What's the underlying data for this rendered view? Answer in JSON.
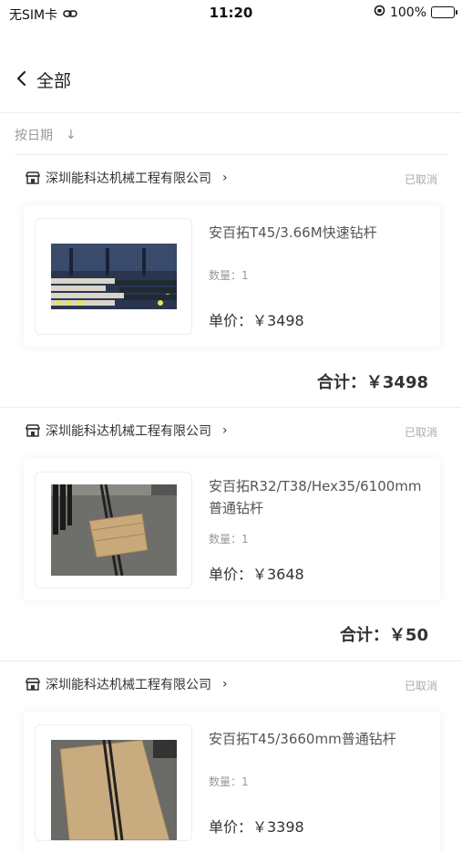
{
  "status_bar": {
    "carrier": "无SIM卡",
    "time": "11:20",
    "battery": "100%"
  },
  "nav": {
    "title": "全部"
  },
  "sort": {
    "label": "按日期",
    "arrow": "↓"
  },
  "orders": [
    {
      "shop": "深圳能科达机械工程有限公司",
      "status": "已取消",
      "product_line1": "安百拓T45/3.66M快速钻杆",
      "product_line2": "",
      "qty_label": "数量：1",
      "unit_price": "单价：￥3498",
      "total": "合计：￥3498"
    },
    {
      "shop": "深圳能科达机械工程有限公司",
      "status": "已取消",
      "product_line1": "安百拓R32/T38/Hex35/6100mm",
      "product_line2": "普通钻杆",
      "qty_label": "数量：1",
      "unit_price": "单价：￥3648",
      "total": "合计：￥50"
    },
    {
      "shop": "深圳能科达机械工程有限公司",
      "status": "已取消",
      "product_line1": "安百拓T45/3660mm普通钻杆",
      "product_line2": "",
      "qty_label": "数量：1",
      "unit_price": "单价：￥3398",
      "total": ""
    }
  ]
}
